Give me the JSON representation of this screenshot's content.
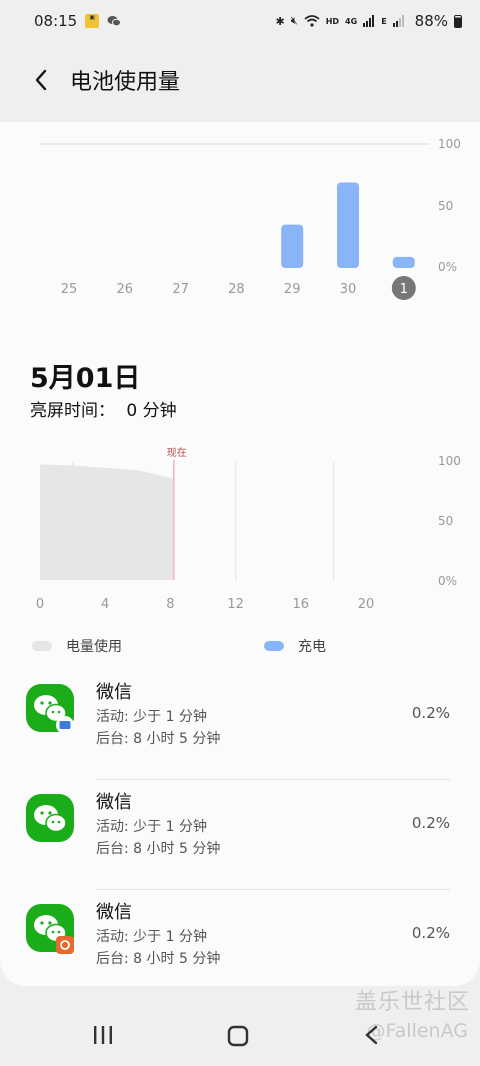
{
  "status_bar": {
    "time": "08:15",
    "battery_percent": "88%",
    "icons": [
      "notification-badge-icon",
      "wechat-icon",
      "bluetooth-icon",
      "mute-icon",
      "wifi-icon",
      "hd-icon",
      "4g-icon",
      "signal-icon",
      "e-icon",
      "signal-icon",
      "battery-icon"
    ]
  },
  "header": {
    "title": "电池使用量",
    "back_icon": "chevron-left-icon"
  },
  "weekly_chart": {
    "y_ticks": [
      "100",
      "50",
      "0%"
    ],
    "x_labels": [
      "25",
      "26",
      "27",
      "28",
      "29",
      "30",
      "1"
    ],
    "selected_label": "1",
    "bar_color": "#8ab4f8"
  },
  "day_summary": {
    "date": "5月01日",
    "screen_time_label": "亮屏时间：",
    "screen_time_value": "0 分钟"
  },
  "daily_chart": {
    "now_label": "现在",
    "y_ticks": [
      "100",
      "50",
      "0%"
    ],
    "x_labels": [
      "0",
      "4",
      "8",
      "12",
      "16",
      "20"
    ],
    "fill_color": "#e6e6e6"
  },
  "legend": {
    "usage_label": "电量使用",
    "usage_color": "#e6e6e6",
    "charge_label": "充电",
    "charge_color": "#8ab4f8"
  },
  "apps": [
    {
      "name": "微信",
      "active": "活动: 少于 1 分钟",
      "background": "后台: 8 小时 5 分钟",
      "percent": "0.2%",
      "badge": "folder-badge-icon"
    },
    {
      "name": "微信",
      "active": "活动: 少于 1 分钟",
      "background": "后台: 8 小时 5 分钟",
      "percent": "0.2%",
      "badge": ""
    },
    {
      "name": "微信",
      "active": "活动: 少于 1 分钟",
      "background": "后台: 8 小时 5 分钟",
      "percent": "0.2%",
      "badge": "dual-app-badge-icon"
    }
  ],
  "watermark": {
    "line1": "盖乐世社区",
    "line2": "@FallenAG"
  },
  "chart_data": [
    {
      "type": "bar",
      "categories": [
        "25",
        "26",
        "27",
        "28",
        "29",
        "30",
        "1"
      ],
      "values": [
        0,
        0,
        0,
        0,
        35,
        69,
        9
      ],
      "ylim": [
        0,
        100
      ]
    },
    {
      "type": "area",
      "x": [
        0,
        2,
        4,
        6,
        8.2
      ],
      "values": [
        98,
        97,
        95,
        93,
        86
      ],
      "xlim": [
        0,
        24
      ],
      "ylim": [
        0,
        100
      ]
    }
  ]
}
